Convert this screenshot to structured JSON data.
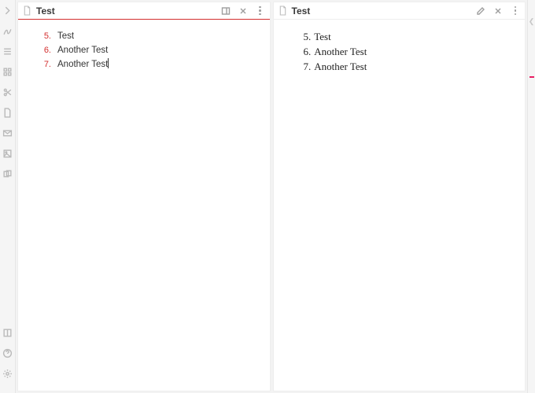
{
  "editor": {
    "title": "Test",
    "active": true,
    "start": 5,
    "caret_index": 2,
    "items": [
      "Test",
      "Another Test",
      "Another Test"
    ]
  },
  "preview": {
    "title": "Test",
    "start": 5,
    "items": [
      "Test",
      "Another Test",
      "Another Test"
    ]
  },
  "rail_icons": [
    "chevron-right-icon",
    "acrobat-icon",
    "list-icon",
    "grid-icon",
    "scissors-icon",
    "page-icon",
    "mail-icon",
    "image-icon",
    "cards-icon"
  ],
  "rail_bottom_icons": [
    "book-icon",
    "help-icon",
    "settings-icon"
  ]
}
